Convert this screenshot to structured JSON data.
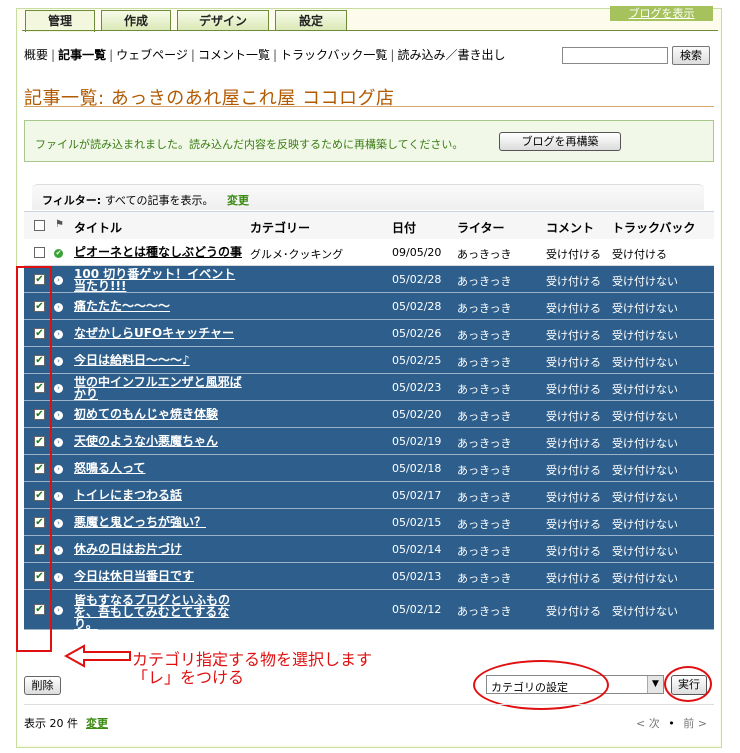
{
  "tabs": [
    "管理",
    "作成",
    "デザイン",
    "設定"
  ],
  "blog_link": "ブログを表示",
  "subnav": [
    "概要",
    "記事一覧",
    "ウェブページ",
    "コメント一覧",
    "トラックバック一覧",
    "読み込み／書き出し"
  ],
  "search_button": "検索",
  "page_title": "記事一覧: あっきのあれ屋これ屋 ココログ店",
  "notice": {
    "text": "ファイルが読み込まれました。読み込んだ内容を反映するために再構築してください。",
    "button": "ブログを再構築"
  },
  "filter": {
    "label": "フィルター:",
    "value": "すべての記事を表示。",
    "change": "変更"
  },
  "table": {
    "headers": [
      "タイトル",
      "カテゴリー",
      "日付",
      "ライター",
      "コメント",
      "トラックバック"
    ],
    "rows": [
      {
        "title": "ピオーネとは種なしぶどうの事",
        "category": "グルメ･クッキング",
        "date": "09/05/20",
        "writer": "あっきっき",
        "comment": "受け付ける",
        "trackback": "受け付ける"
      },
      {
        "title": "100 切り番ゲット！イベント当たり!!!",
        "category": "",
        "date": "05/02/28",
        "writer": "あっきっき",
        "comment": "受け付ける",
        "trackback": "受け付けない"
      },
      {
        "title": "痛たたた～～～～",
        "category": "",
        "date": "05/02/28",
        "writer": "あっきっき",
        "comment": "受け付ける",
        "trackback": "受け付けない"
      },
      {
        "title": "なぜかしらUFOキャッチャー",
        "category": "",
        "date": "05/02/26",
        "writer": "あっきっき",
        "comment": "受け付ける",
        "trackback": "受け付けない"
      },
      {
        "title": "今日は給料日～～～♪",
        "category": "",
        "date": "05/02/25",
        "writer": "あっきっき",
        "comment": "受け付ける",
        "trackback": "受け付けない"
      },
      {
        "title": "世の中インフルエンザと風邪ばかり",
        "category": "",
        "date": "05/02/23",
        "writer": "あっきっき",
        "comment": "受け付ける",
        "trackback": "受け付けない"
      },
      {
        "title": "初めてのもんじゃ焼き体験",
        "category": "",
        "date": "05/02/20",
        "writer": "あっきっき",
        "comment": "受け付ける",
        "trackback": "受け付けない"
      },
      {
        "title": "天使のような小悪魔ちゃん",
        "category": "",
        "date": "05/02/19",
        "writer": "あっきっき",
        "comment": "受け付ける",
        "trackback": "受け付けない"
      },
      {
        "title": "怒鳴る人って",
        "category": "",
        "date": "05/02/18",
        "writer": "あっきっき",
        "comment": "受け付ける",
        "trackback": "受け付けない"
      },
      {
        "title": "トイレにまつわる話",
        "category": "",
        "date": "05/02/17",
        "writer": "あっきっき",
        "comment": "受け付ける",
        "trackback": "受け付けない"
      },
      {
        "title": "悪魔と鬼どっちが強い？",
        "category": "",
        "date": "05/02/15",
        "writer": "あっきっき",
        "comment": "受け付ける",
        "trackback": "受け付けない"
      },
      {
        "title": "休みの日はお片づけ",
        "category": "",
        "date": "05/02/14",
        "writer": "あっきっき",
        "comment": "受け付ける",
        "trackback": "受け付けない"
      },
      {
        "title": "今日は休日当番日です",
        "category": "",
        "date": "05/02/13",
        "writer": "あっきっき",
        "comment": "受け付ける",
        "trackback": "受け付けない"
      },
      {
        "title": "皆もすなるブログといふものを、吾もしてみむとてするなり。",
        "category": "",
        "date": "05/02/12",
        "writer": "あっきっき",
        "comment": "受け付ける",
        "trackback": "受け付けない"
      }
    ]
  },
  "annotation": {
    "line1": "カテゴリ指定する物を選択します",
    "line2": "「レ」をつける"
  },
  "delete_button": "削除",
  "action_select": "カテゴリの設定",
  "run_button": "実行",
  "count": {
    "label": "表示 20 件",
    "change": "変更"
  },
  "pager": {
    "prev": "< 次",
    "next": "前 >"
  },
  "colors": {
    "selected_row": "#2e5f8c",
    "title": "#b15a00",
    "tab_border": "#6f8c3a",
    "annotation": "#e01010"
  }
}
